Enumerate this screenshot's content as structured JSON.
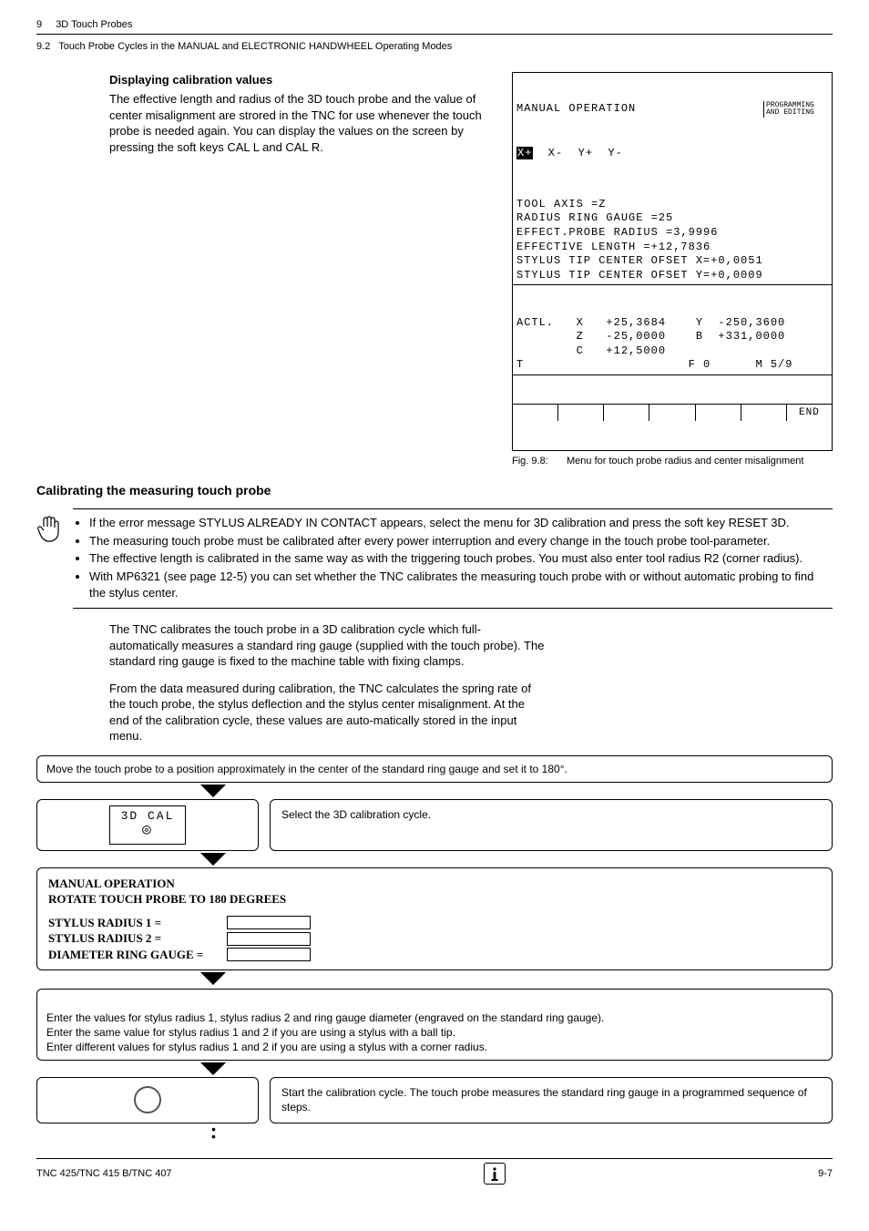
{
  "header": {
    "chapnum": "9",
    "chapter": "3D Touch Probes"
  },
  "subheader": {
    "sec": "9.2",
    "title": "Touch Probe Cycles in the MANUAL and ELECTRONIC HANDWHEEL Operating Modes"
  },
  "display_block": {
    "h": "Displaying calibration values",
    "p": "The effective length and radius of the 3D touch probe and the value of center misalignment are strored in the TNC for use whenever the touch probe is needed again. You can display the values on the screen by pressing the soft keys CAL L and CAL R."
  },
  "screen": {
    "title": "MANUAL OPERATION",
    "mode": "PROGRAMMING\nAND EDITING",
    "axesrow": "X+  X-  Y+  Y-",
    "body1": "TOOL AXIS =Z",
    "body2": "RADIUS RING GAUGE =25",
    "body3": "EFFECT.PROBE RADIUS =3,9996",
    "body4": "EFFECTIVE LENGTH =+12,7836",
    "body5": "STYLUS TIP CENTER OFSET X=+0,0051",
    "body6": "STYLUS TIP CENTER OFSET Y=+0,0009",
    "pos1": "ACTL.   X   +25,3684    Y  -250,3600",
    "pos2": "        Z   -25,0000    B  +331,0000",
    "pos3": "        C   +12,5000",
    "pos4": "T                      F 0      M 5/9",
    "sk_end": "END"
  },
  "figcap": {
    "l": "Fig. 9.8:",
    "t": "Menu for touch probe radius and center misalignment"
  },
  "h2": "Calibrating the measuring touch probe",
  "bullets": {
    "b1": "If the error message STYLUS ALREADY IN CONTACT appears, select the menu for 3D calibration and press the soft key RESET 3D.",
    "b2": "The measuring touch probe must be calibrated after every power interruption and every change in the touch probe tool-parameter.",
    "b3": "The effective length is calibrated in the same way as with the triggering touch probes. You must also enter tool radius R2 (corner radius).",
    "b4": "With MP6321 (see page 12-5) you can set whether the TNC calibrates the measuring touch probe with or without automatic probing to find the stylus center."
  },
  "para1": "The TNC calibrates the touch probe in a 3D calibration cycle which full-automatically measures a standard ring gauge (supplied with the touch probe). The standard ring gauge is fixed to the machine table with fixing clamps.",
  "para2": "From the data measured during calibration, the TNC calculates the spring rate of the touch probe, the stylus deflection and the stylus center misalignment. At the end of the calibration cycle, these values are auto-matically stored in the input menu.",
  "step1": "Move the touch probe to a position approximately in the center of the standard ring gauge and set it to 180°.",
  "step2": {
    "btn": "3D CAL",
    "desc": "Select the 3D calibration cycle."
  },
  "prompt": {
    "l1": "MANUAL OPERATION",
    "l2": "ROTATE TOUCH PROBE TO 180 DEGREES",
    "f1": "STYLUS RADIUS 1 =",
    "f2": "STYLUS RADIUS 2 =",
    "f3": "DIAMETER RING GAUGE ="
  },
  "step3": "Enter the values for stylus radius 1, stylus radius 2 and ring gauge diameter (engraved on the standard ring gauge).\nEnter the same value for stylus radius 1 and 2 if you are using a stylus with a ball tip.\nEnter different values for stylus radius 1 and 2 if you are using a stylus with a corner radius.",
  "step4": {
    "desc": "Start the calibration cycle. The touch probe measures the standard ring gauge in a programmed sequence of steps."
  },
  "footer": {
    "left": "TNC 425/TNC 415 B/TNC 407",
    "right": "9-7"
  }
}
